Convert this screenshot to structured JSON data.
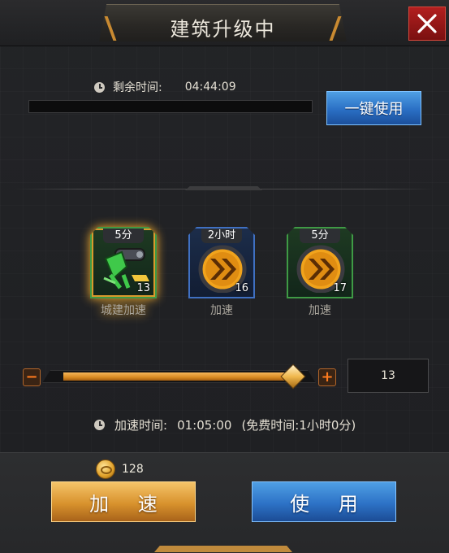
{
  "header": {
    "title": "建筑升级中"
  },
  "remaining": {
    "label": "剩余时间:",
    "value": "04:44:09",
    "progress": 0.0
  },
  "buttons": {
    "one_key": "一键使用",
    "speed": "加 速",
    "use": "使 用"
  },
  "items": [
    {
      "time": "5分",
      "count": "13",
      "label": "城建加速",
      "rarity": "green",
      "icon": "construction-speedup-icon",
      "selected": true
    },
    {
      "time": "2小时",
      "count": "16",
      "label": "加速",
      "rarity": "blue",
      "icon": "speedup-chevron-icon",
      "selected": false
    },
    {
      "time": "5分",
      "count": "17",
      "label": "加速",
      "rarity": "green",
      "icon": "speedup-chevron-icon",
      "selected": false
    }
  ],
  "slider": {
    "value": 13,
    "max": 13,
    "fraction": 1.0,
    "quantity": "13"
  },
  "speedup": {
    "label": "加速时间:",
    "value": "01:05:00",
    "free_note": "(免费时间:1小时0分)"
  },
  "cost": {
    "amount": "128"
  },
  "colors": {
    "accent_orange": "#d98a22",
    "accent_blue": "#2d72c6",
    "close_red": "#b21f1f"
  }
}
